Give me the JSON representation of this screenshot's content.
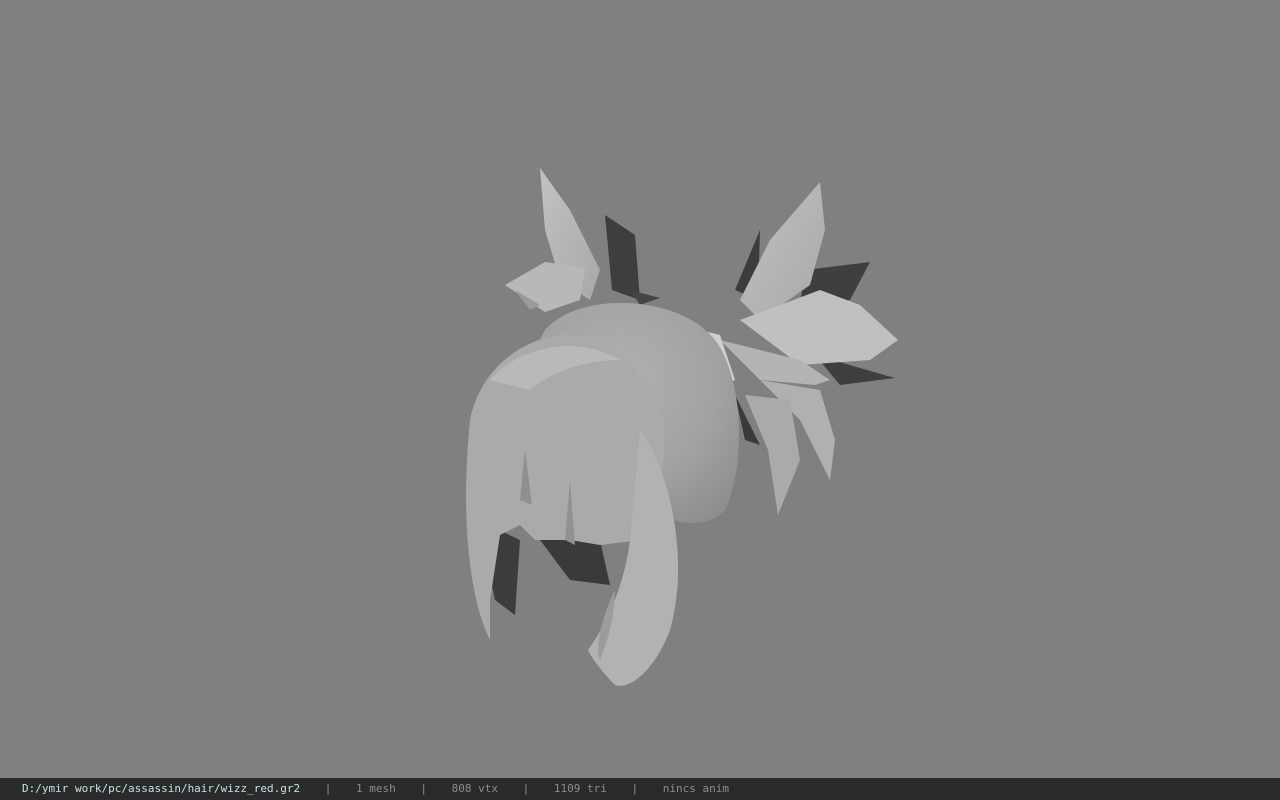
{
  "viewer": {
    "background_color": "#808080",
    "model_icon": "hair-model-3d"
  },
  "status_bar": {
    "file_path": "D:/ymir work/pc/assassin/hair/wizz_red.gr2",
    "separator": "|",
    "mesh_count": "1 mesh",
    "vertex_count": "808 vtx",
    "triangle_count": "1109 tri",
    "animation": "nincs anim",
    "path_color": "#bfe3ea",
    "text_color": "#8c8c8c"
  }
}
